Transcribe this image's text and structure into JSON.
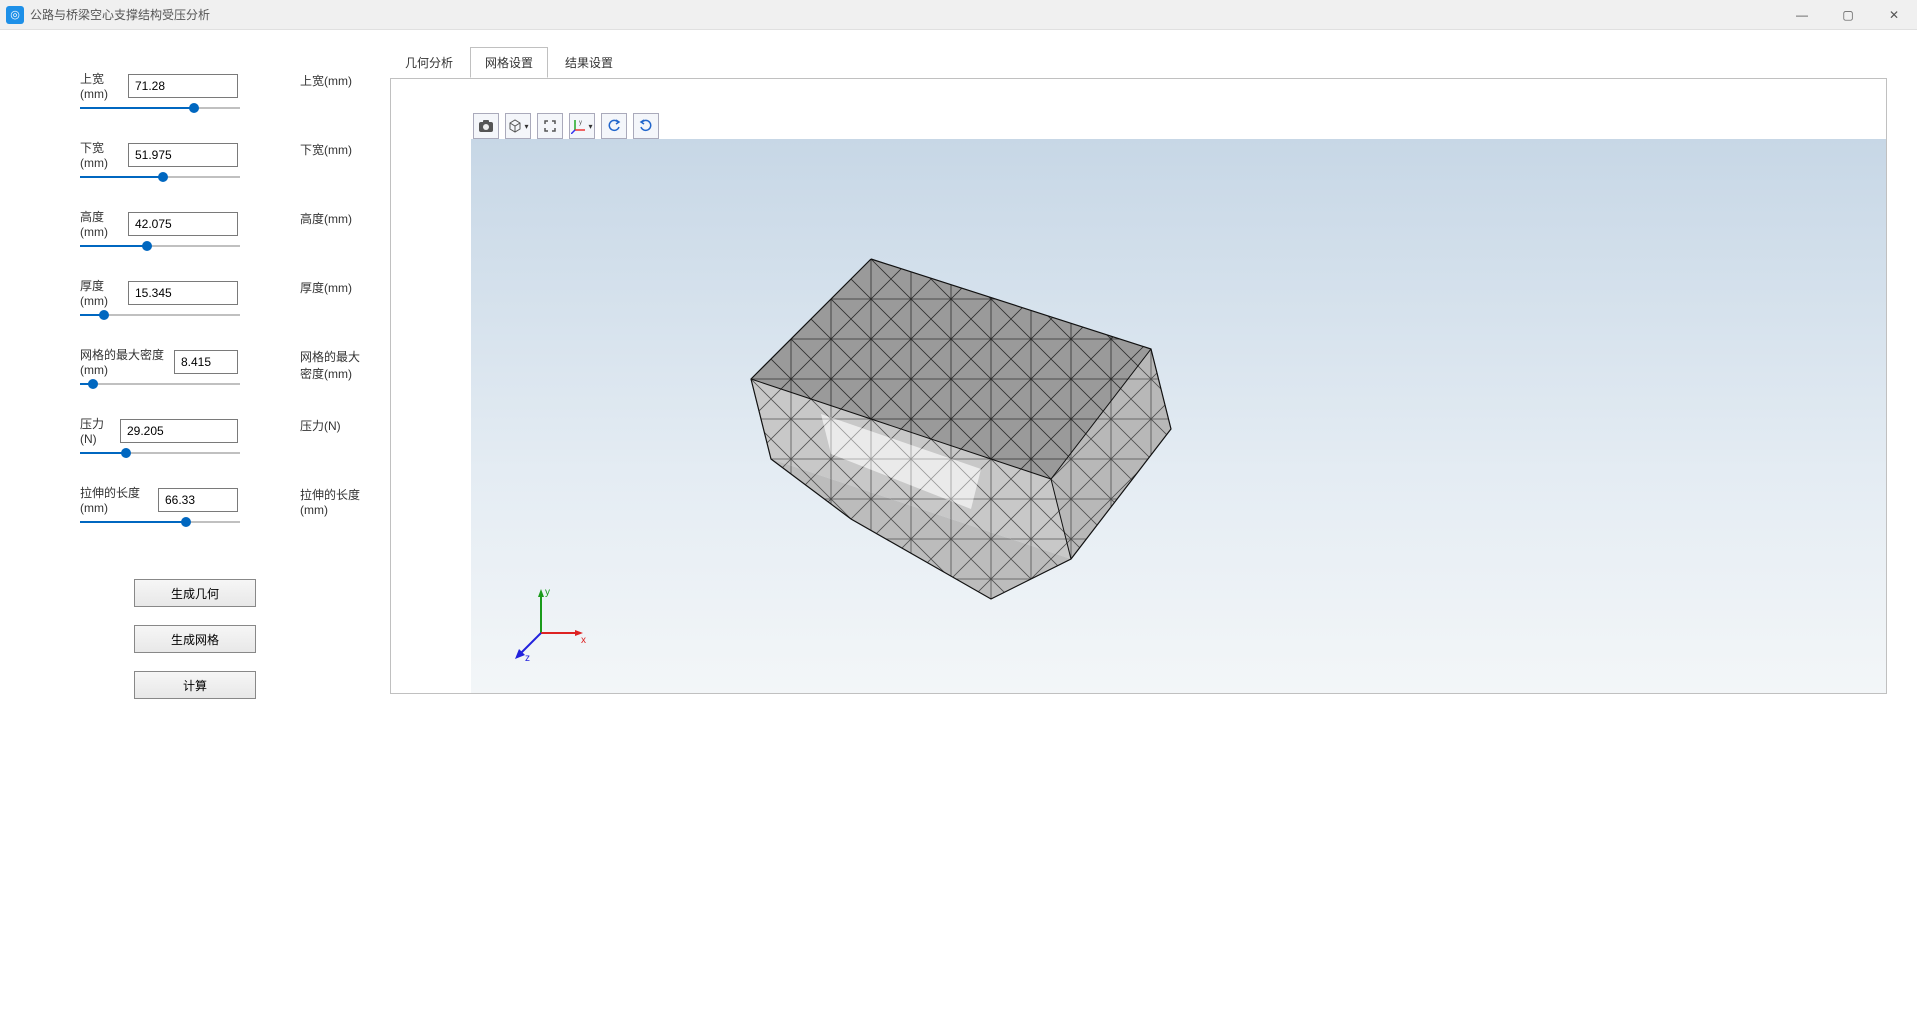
{
  "window": {
    "title": "公路与桥梁空心支撑结构受压分析"
  },
  "params": [
    {
      "label": "上宽(mm)",
      "value": "71.28",
      "rlabel": "上宽(mm)",
      "fillPct": 71,
      "sliderW": 160,
      "lblW": 48,
      "inputW": 110
    },
    {
      "label": "下宽(mm)",
      "value": "51.975",
      "rlabel": "下宽(mm)",
      "fillPct": 52,
      "sliderW": 160,
      "lblW": 48,
      "inputW": 110
    },
    {
      "label": "高度(mm)",
      "value": "42.075",
      "rlabel": "高度(mm)",
      "fillPct": 42,
      "sliderW": 160,
      "lblW": 48,
      "inputW": 110
    },
    {
      "label": "厚度(mm)",
      "value": "15.345",
      "rlabel": "厚度(mm)",
      "fillPct": 15,
      "sliderW": 160,
      "lblW": 48,
      "inputW": 110
    },
    {
      "label": "网格的最大密度(mm)",
      "value": "8.415",
      "rlabel": "网格的最大密度(mm)",
      "fillPct": 8,
      "sliderW": 160,
      "lblW": 94,
      "inputW": 64
    },
    {
      "label": "压力(N)",
      "value": "29.205",
      "rlabel": "压力(N)",
      "fillPct": 29,
      "sliderW": 160,
      "lblW": 40,
      "inputW": 118
    },
    {
      "label": "拉伸的长度(mm)",
      "value": "66.33",
      "rlabel": "拉伸的长度(mm)",
      "fillPct": 66,
      "sliderW": 160,
      "lblW": 78,
      "inputW": 80
    }
  ],
  "buttons": {
    "gen_geometry": "生成几何",
    "gen_mesh": "生成网格",
    "calculate": "计算"
  },
  "tabs": [
    {
      "label": "几何分析",
      "active": false
    },
    {
      "label": "网格设置",
      "active": true
    },
    {
      "label": "结果设置",
      "active": false
    }
  ],
  "axis": {
    "x": "x",
    "y": "y",
    "z": "z"
  },
  "toolbar_icons": [
    "camera",
    "cube",
    "expand",
    "axes",
    "rotate-ccw",
    "rotate-cw"
  ]
}
